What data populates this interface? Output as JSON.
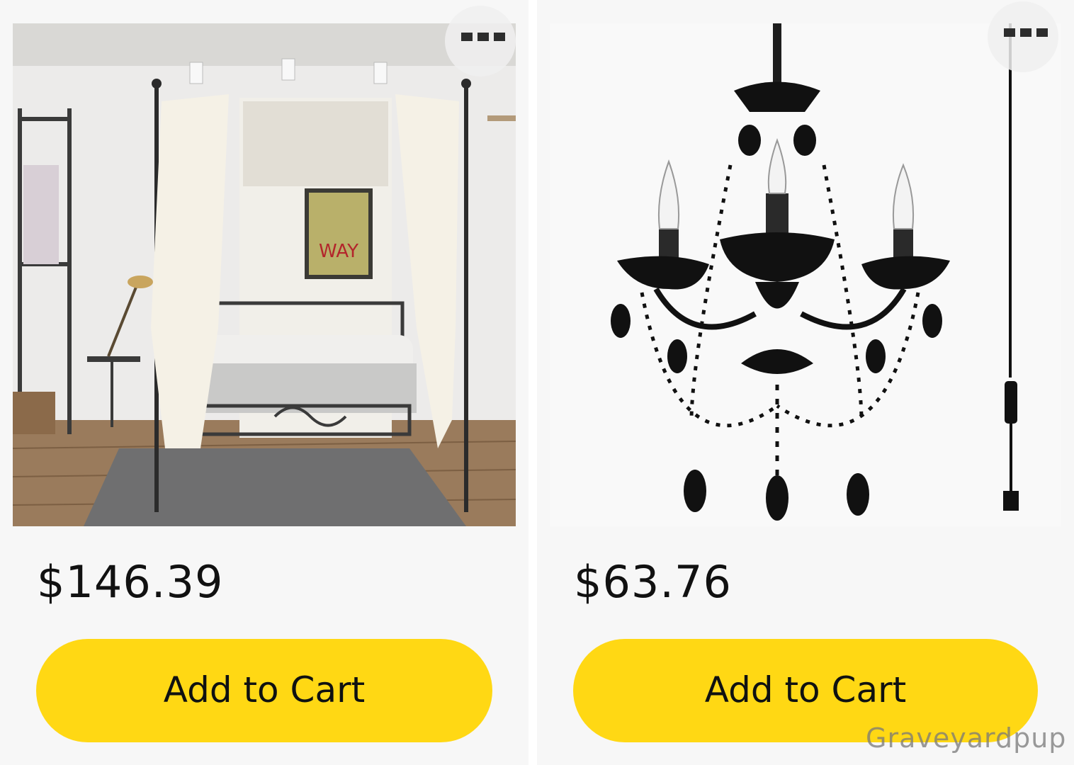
{
  "products": [
    {
      "name_icon": "canopy-bed-image",
      "price": "$146.39",
      "button_label": "Add to Cart",
      "poster_text": "WAY"
    },
    {
      "name_icon": "chandelier-image",
      "price": "$63.76",
      "button_label": "Add to Cart"
    }
  ],
  "watermark": "Graveyardpup",
  "colors": {
    "button": "#ffd814",
    "card_bg": "#f7f7f7",
    "text": "#111111"
  }
}
